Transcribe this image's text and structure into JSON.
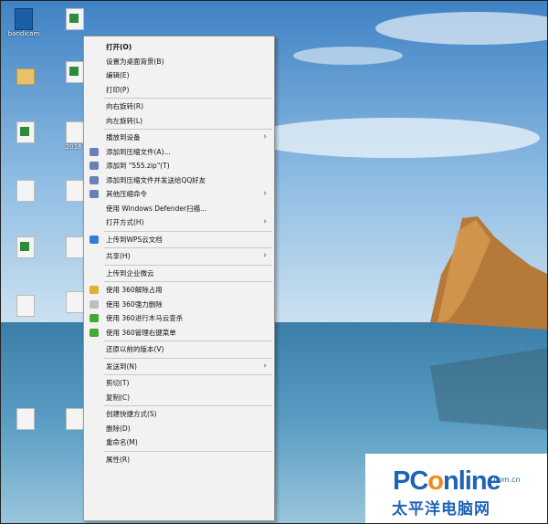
{
  "desktop": {
    "icons": [
      {
        "label": "bandicam",
        "kind": "blue"
      },
      {
        "label": "",
        "kind": "green"
      },
      {
        "label": "",
        "kind": "folder"
      },
      {
        "label": "",
        "kind": "green"
      },
      {
        "label": "",
        "kind": "green"
      },
      {
        "label": "2016-",
        "kind": "plain"
      },
      {
        "label": "",
        "kind": "plain"
      },
      {
        "label": "",
        "kind": "plain"
      },
      {
        "label": "",
        "kind": "green"
      },
      {
        "label": "",
        "kind": "plain"
      },
      {
        "label": "",
        "kind": "plain"
      },
      {
        "label": "",
        "kind": "plain"
      },
      {
        "label": "",
        "kind": "plain"
      },
      {
        "label": "",
        "kind": "plain"
      }
    ]
  },
  "context_menu": {
    "items": [
      {
        "label": "打开(O)",
        "bold": true
      },
      {
        "label": "设置为桌面背景(B)"
      },
      {
        "label": "编辑(E)"
      },
      {
        "label": "打印(P)"
      },
      {
        "sep": true
      },
      {
        "label": "向右旋转(R)"
      },
      {
        "label": "向左旋转(L)"
      },
      {
        "sep": true
      },
      {
        "label": "播放到设备",
        "arrow": true
      },
      {
        "label": "添加到压缩文件(A)...",
        "icon": "archive-icon",
        "icon_color": "#6b7fb8"
      },
      {
        "label": "添加到 \"555.zip\"(T)",
        "icon": "archive-icon",
        "icon_color": "#6b7fb8"
      },
      {
        "label": "添加到压缩文件并发送给QQ好友",
        "icon": "archive-icon",
        "icon_color": "#6b7fb8"
      },
      {
        "label": "其他压缩命令",
        "icon": "archive-icon",
        "icon_color": "#6b7fb8",
        "arrow": true
      },
      {
        "label": "使用 Windows Defender扫描..."
      },
      {
        "label": "打开方式(H)",
        "arrow": true
      },
      {
        "sep": true
      },
      {
        "label": "上传到WPS云文档",
        "icon": "cloud-icon",
        "icon_color": "#3a7bd5"
      },
      {
        "sep": true
      },
      {
        "label": "共享(H)",
        "arrow": true
      },
      {
        "sep": true
      },
      {
        "label": "上传到企业微云"
      },
      {
        "sep": true
      },
      {
        "label": "使用 360解除占用",
        "icon": "unlock-360-icon",
        "icon_color": "#e0b030"
      },
      {
        "label": "使用 360强力删除",
        "icon": "shred-360-icon",
        "icon_color": "#bfbfbf"
      },
      {
        "label": "使用 360进行木马云查杀",
        "icon": "scan-360-icon",
        "icon_color": "#44a832"
      },
      {
        "label": "使用 360管理右键菜单",
        "icon": "menu-360-icon",
        "icon_color": "#44a832"
      },
      {
        "sep": true
      },
      {
        "label": "还原以前的版本(V)"
      },
      {
        "sep": true
      },
      {
        "label": "发送到(N)",
        "arrow": true
      },
      {
        "sep": true
      },
      {
        "label": "剪切(T)"
      },
      {
        "label": "复制(C)"
      },
      {
        "sep": true
      },
      {
        "label": "创建快捷方式(S)"
      },
      {
        "label": "删除(D)"
      },
      {
        "label": "重命名(M)"
      },
      {
        "sep": true
      },
      {
        "label": "属性(R)"
      }
    ]
  },
  "watermark": {
    "brand_pc": "PC",
    "brand_o": "o",
    "brand_rest": "nline",
    "domain": ".com.cn",
    "chinese": "太平洋电脑网"
  },
  "colors": {
    "sky": "#5f9bd0",
    "sea": "#2f6f95",
    "rock": "#c98a3f",
    "annotation_arrow": "#e53030",
    "brand": "#1f63b3"
  }
}
